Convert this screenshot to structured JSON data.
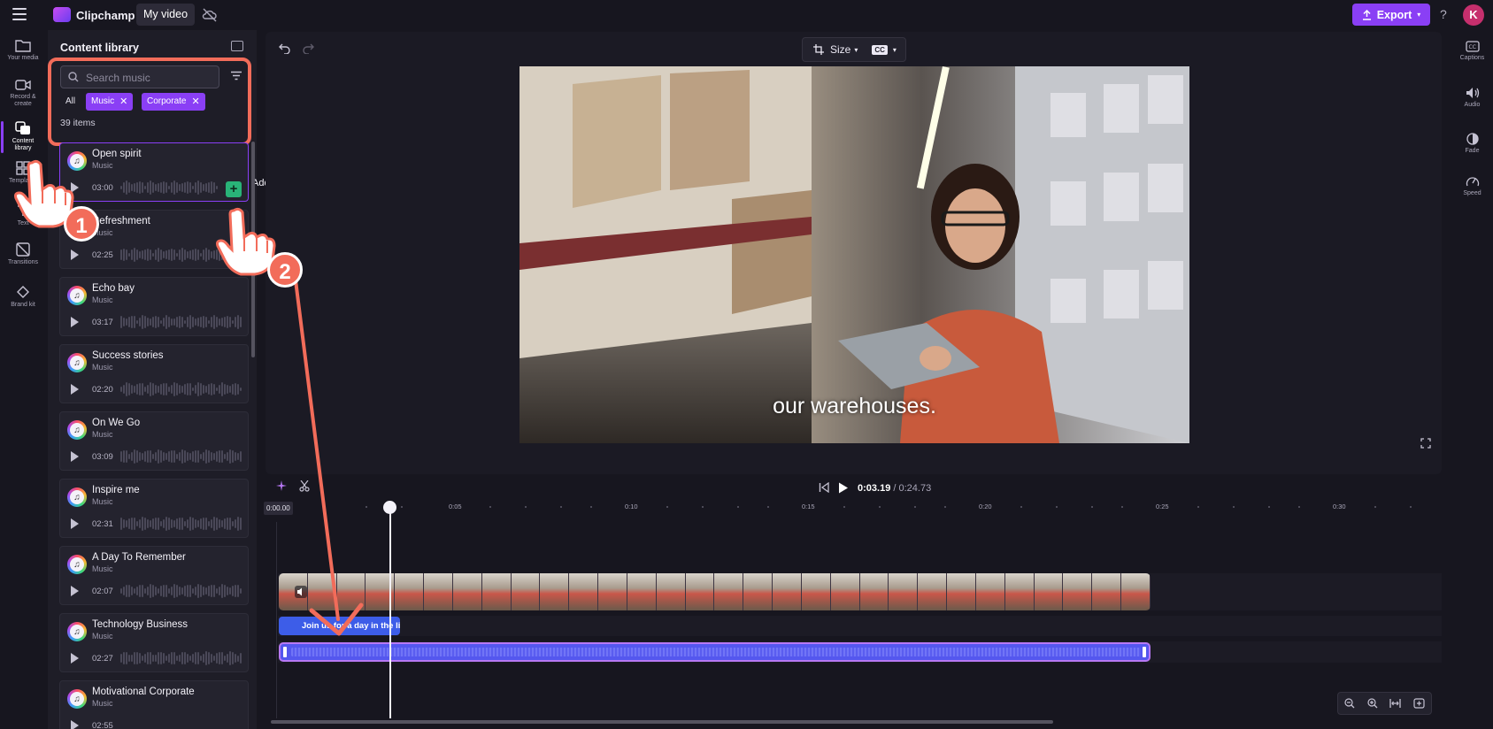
{
  "app": {
    "name": "Clipchamp",
    "project_tab": "My video",
    "export_label": "Export",
    "help_label": "?",
    "avatar_initial": "K",
    "accent_color": "#8a3ff5"
  },
  "left_rail": {
    "items": [
      {
        "label": "Your media",
        "icon": "folder-icon"
      },
      {
        "label": "Record & create",
        "icon": "camera-icon"
      },
      {
        "label": "Content library",
        "icon": "library-icon",
        "active": true
      },
      {
        "label": "Templates",
        "icon": "templates-icon"
      },
      {
        "label": "Text",
        "icon": "text-icon"
      },
      {
        "label": "Transitions",
        "icon": "transitions-icon"
      },
      {
        "label": "Brand kit",
        "icon": "brand-kit-icon"
      }
    ]
  },
  "library": {
    "title": "Content library",
    "search_placeholder": "Search music",
    "filter_all": "All",
    "chips": [
      "Music",
      "Corporate"
    ],
    "items_count": "39 items",
    "add_tooltip": "Add to timeline",
    "tracks": [
      {
        "title": "Open spirit",
        "type": "Music",
        "duration": "03:00"
      },
      {
        "title": "Refreshment",
        "type": "Music",
        "duration": "02:25"
      },
      {
        "title": "Echo bay",
        "type": "Music",
        "duration": "03:17"
      },
      {
        "title": "Success stories",
        "type": "Music",
        "duration": "02:20"
      },
      {
        "title": "On We Go",
        "type": "Music",
        "duration": "03:09"
      },
      {
        "title": "Inspire me",
        "type": "Music",
        "duration": "02:31"
      },
      {
        "title": "A Day To Remember",
        "type": "Music",
        "duration": "02:07"
      },
      {
        "title": "Technology Business",
        "type": "Music",
        "duration": "02:27"
      },
      {
        "title": "Motivational Corporate",
        "type": "Music",
        "duration": "02:55"
      }
    ]
  },
  "right_rail": {
    "items": [
      {
        "label": "Captions",
        "icon": "captions-icon"
      },
      {
        "label": "Audio",
        "icon": "audio-icon"
      },
      {
        "label": "Fade",
        "icon": "fade-icon"
      },
      {
        "label": "Speed",
        "icon": "speed-icon"
      }
    ]
  },
  "preview": {
    "size_label": "Size",
    "cc_label": "CC",
    "caption_text": "our warehouses."
  },
  "playback": {
    "current_time": "0:03.19",
    "separator": " / ",
    "total_time": "0:24.73"
  },
  "timeline": {
    "start_label": "0:00.00",
    "ticks": [
      "0:05",
      "0:10",
      "0:15",
      "0:20",
      "0:25",
      "0:30"
    ],
    "caption_clip_text": "Join us for a day in the life"
  },
  "annotations": {
    "step1": "1",
    "step2": "2",
    "highlight_color": "#f26c5a"
  }
}
